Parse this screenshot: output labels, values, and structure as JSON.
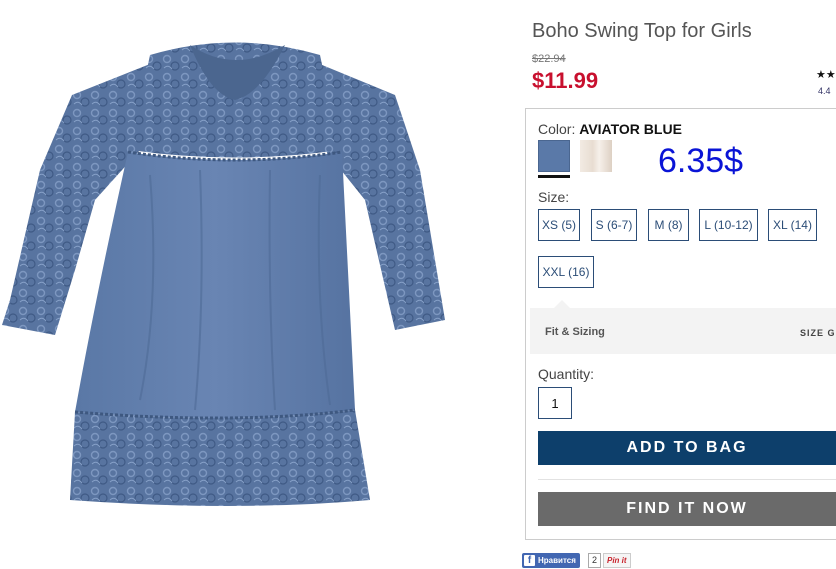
{
  "product": {
    "title": "Boho Swing Top for Girls",
    "old_price": "$22.94",
    "price": "$11.99",
    "stars": "★★",
    "rating": "4.4",
    "image_icon": "blouse-image"
  },
  "color": {
    "label": "Color:",
    "selected": "AVIATOR BLUE",
    "swatches": [
      "aviator-blue",
      "ivory"
    ],
    "swatch_colors": [
      "#5a79a8",
      "#efe6dc"
    ]
  },
  "annotation": "6.35$",
  "size": {
    "label": "Size:",
    "options": [
      "XS (5)",
      "S (6-7)",
      "M (8)",
      "L (10-12)",
      "XL (14)",
      "XXL (16)"
    ]
  },
  "fit": {
    "label": "Fit & Sizing",
    "guide": "SIZE GI"
  },
  "quantity": {
    "label": "Quantity:",
    "value": "1"
  },
  "buttons": {
    "add_to_bag": "ADD TO BAG",
    "find_it_now": "FIND IT NOW"
  },
  "social": {
    "fb_label": "Нравится",
    "fb_count": "2",
    "pin_label": "Pin it"
  },
  "colors": {
    "price_red": "#c8102e",
    "navy": "#0d3f6b",
    "gray_button": "#6a6a6a",
    "annotation_blue": "#0a14d6"
  }
}
